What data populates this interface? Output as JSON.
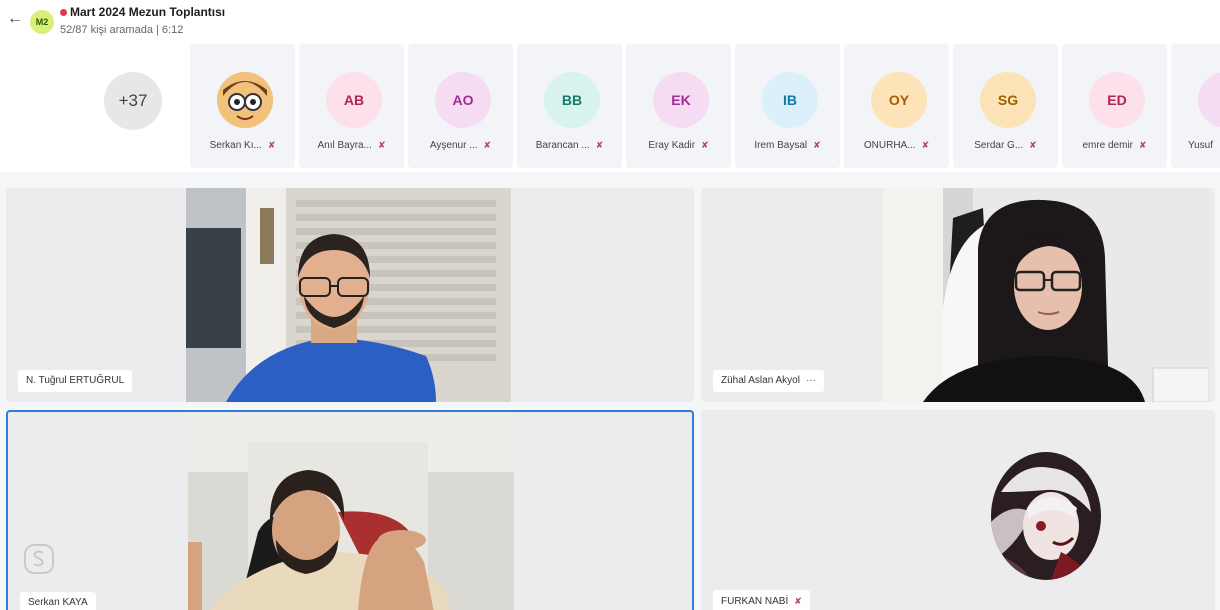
{
  "header": {
    "back_icon": "back-arrow-icon",
    "group_initials": "M2",
    "title": "Mart 2024 Mezun Toplantısı",
    "subtitle": "52/87 kişi aramada | 6:12",
    "live_color": "#e0394b"
  },
  "strip": {
    "more_label": "+37",
    "participants": [
      {
        "initials": "",
        "name": "Serkan Kı...",
        "avatar": "cartoon-avatar",
        "bg": "#f4d9a6",
        "fg": "#5a3a10"
      },
      {
        "initials": "AB",
        "name": "Anıl Bayra...",
        "bg": "#fde1ea",
        "fg": "#b0264f"
      },
      {
        "initials": "AO",
        "name": "Ayşenur ...",
        "bg": "#f6dcf3",
        "fg": "#a12d95"
      },
      {
        "initials": "BB",
        "name": "Barancan ...",
        "bg": "#d8f3ee",
        "fg": "#157b6a"
      },
      {
        "initials": "EK",
        "name": "Eray Kadir",
        "bg": "#f6dcf3",
        "fg": "#a12d95"
      },
      {
        "initials": "IB",
        "name": "İrem Baysal",
        "bg": "#dcf0fb",
        "fg": "#1a78a8"
      },
      {
        "initials": "OY",
        "name": "ONURHA...",
        "bg": "#fde3b8",
        "fg": "#a55d00"
      },
      {
        "initials": "SG",
        "name": "Serdar G...",
        "bg": "#fde3b8",
        "fg": "#a55d00"
      },
      {
        "initials": "ED",
        "name": "emre demir",
        "bg": "#fde1ea",
        "fg": "#b0264f"
      },
      {
        "initials": "",
        "name": "Yusuf",
        "bg": "#f6dcf3",
        "fg": "#a12d95"
      }
    ]
  },
  "tiles": [
    {
      "name": "N. Tuğrul ERTUĞRUL",
      "extra": ""
    },
    {
      "name": "Zühal Aslan Akyol",
      "extra": "···"
    },
    {
      "name": "Serkan KAYA",
      "extra": ""
    },
    {
      "name": "FURKAN NABİ",
      "extra": "mic-off"
    }
  ],
  "colors": {
    "accent": "#2d7fd3",
    "mic_off": "#b0455e",
    "tile_bg": "#ececef"
  }
}
